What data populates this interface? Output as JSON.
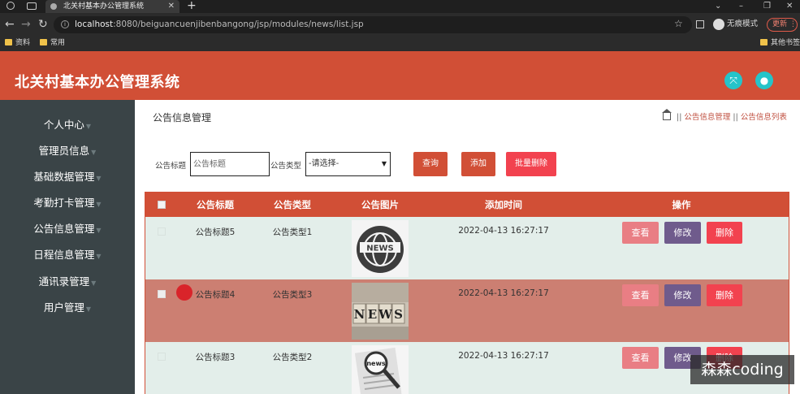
{
  "browser": {
    "tab_title": "北关村基本办公管理系统",
    "url_host": "localhost",
    "url_rest": ":8080/beiguancuenjibenbangong/jsp/modules/news/list.jsp",
    "incognito_label": "无痕模式",
    "update_label": "更新",
    "bookmarks": [
      "资料",
      "常用",
      "其他书签"
    ]
  },
  "header": {
    "title": "北关村基本办公管理系统",
    "icons": [
      "expand-icon",
      "user-icon"
    ]
  },
  "sidebar": {
    "items": [
      {
        "label": "个人中心"
      },
      {
        "label": "管理员信息"
      },
      {
        "label": "基础数据管理"
      },
      {
        "label": "考勤打卡管理"
      },
      {
        "label": "公告信息管理"
      },
      {
        "label": "日程信息管理"
      },
      {
        "label": "通讯录管理"
      },
      {
        "label": "用户管理"
      }
    ]
  },
  "page": {
    "title": "公告信息管理",
    "breadcrumb": [
      "公告信息管理",
      "公告信息列表"
    ]
  },
  "search": {
    "title_label": "公告标题",
    "title_placeholder": "公告标题",
    "type_label": "公告类型",
    "type_selected": "-请选择-",
    "query_label": "查询",
    "add_label": "添加",
    "batch_delete_label": "批量删除"
  },
  "table": {
    "headers": [
      "公告标题",
      "公告类型",
      "公告图片",
      "添加时间",
      "操作"
    ],
    "action_labels": {
      "view": "查看",
      "edit": "修改",
      "delete": "删除"
    },
    "rows": [
      {
        "title": "公告标题5",
        "type": "公告类型1",
        "image": "news-globe-icon",
        "time": "2022-04-13 16:27:17"
      },
      {
        "title": "公告标题4",
        "type": "公告类型3",
        "image": "news-blocks-icon",
        "time": "2022-04-13 16:27:17"
      },
      {
        "title": "公告标题3",
        "type": "公告类型2",
        "image": "news-magnifier-icon",
        "time": "2022-04-13 16:27:17"
      }
    ]
  },
  "watermark": "森森coding",
  "colors": {
    "accent": "#d14f36",
    "sidebar": "#3a4447",
    "row_highlight": "#cc7f72",
    "row_normal": "#e3eeea",
    "view": "#e97e84",
    "edit": "#6f5b8c",
    "delete": "#f2424f",
    "header_icon": "#25c4c9"
  }
}
